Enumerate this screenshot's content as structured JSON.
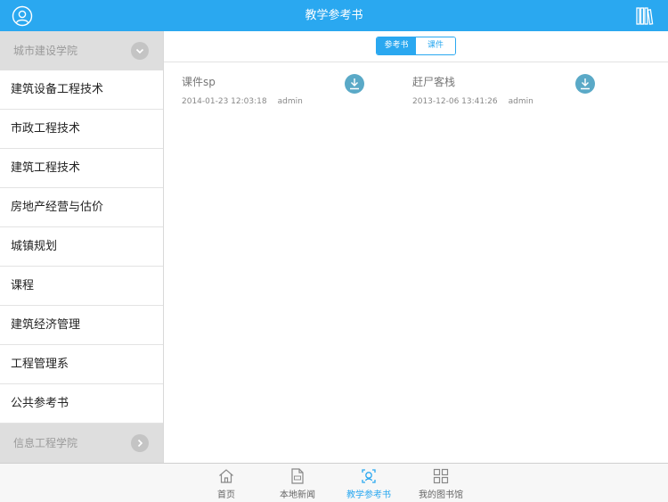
{
  "header": {
    "title": "教学参考书"
  },
  "sidebar": {
    "group_open": {
      "label": "城市建设学院"
    },
    "items": [
      {
        "label": "建筑设备工程技术"
      },
      {
        "label": "市政工程技术"
      },
      {
        "label": "建筑工程技术"
      },
      {
        "label": "房地产经营与估价"
      },
      {
        "label": "城镇规划"
      },
      {
        "label": "课程"
      },
      {
        "label": "建筑经济管理"
      },
      {
        "label": "工程管理系"
      },
      {
        "label": "公共参考书"
      }
    ],
    "group_closed": {
      "label": "信息工程学院"
    }
  },
  "segments": {
    "reference": "参考书",
    "courseware": "课件",
    "selected": "参考书"
  },
  "books": [
    {
      "name": "课件sp",
      "date": "2014-01-23 12:03:18",
      "author": "admin"
    },
    {
      "name": "赶尸客栈",
      "date": "2013-12-06 13:41:26",
      "author": "admin"
    }
  ],
  "tabbar": {
    "tabs": [
      {
        "label": "首页",
        "icon": "home-icon"
      },
      {
        "label": "本地新闻",
        "icon": "news-icon"
      },
      {
        "label": "教学参考书",
        "icon": "reference-book-icon"
      },
      {
        "label": "我的图书馆",
        "icon": "grid-library-icon"
      }
    ],
    "active_index": 2
  },
  "colors": {
    "accent": "#2aa8f0",
    "download": "#5aa9c7"
  }
}
